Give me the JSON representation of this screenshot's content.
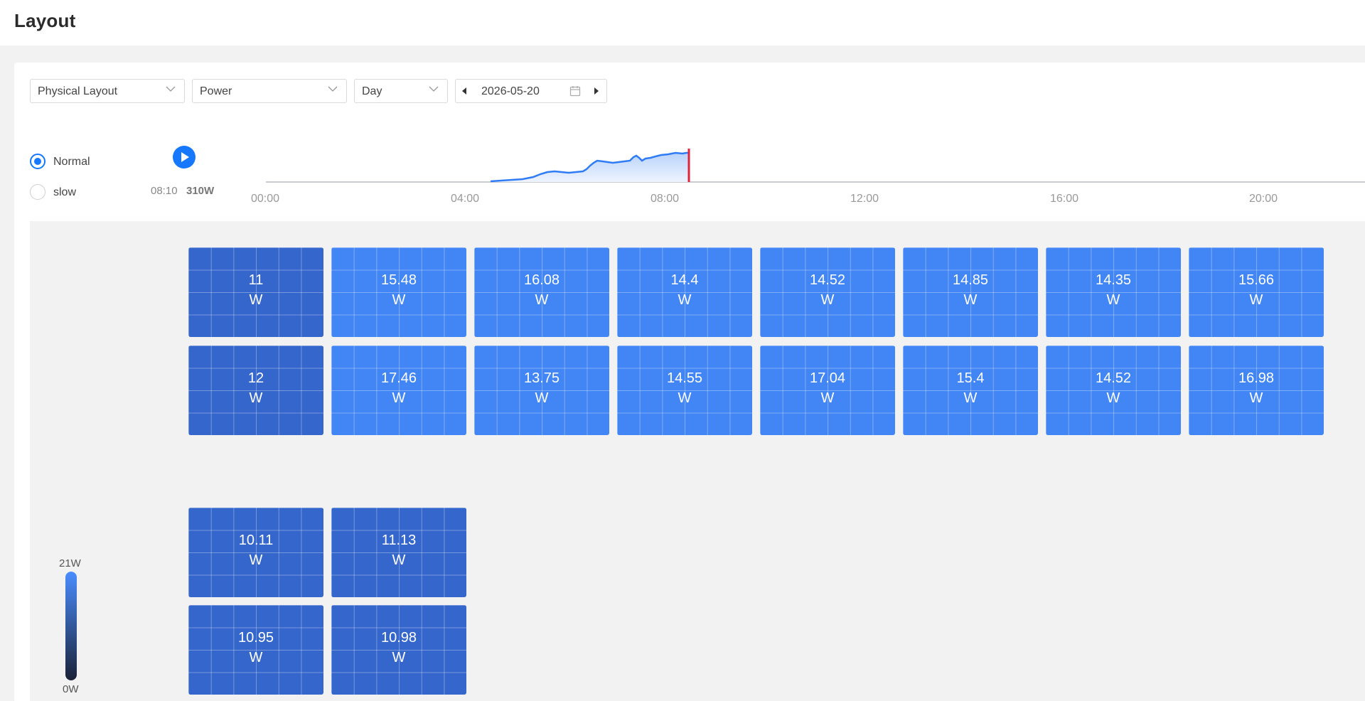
{
  "page": {
    "title": "Layout"
  },
  "filters": {
    "layout_select": "Physical Layout",
    "metric_select": "Power",
    "period_select": "Day",
    "date": "2026-05-20"
  },
  "playback": {
    "speeds": [
      {
        "label": "Normal",
        "selected": true
      },
      {
        "label": "slow",
        "selected": false
      }
    ],
    "current_time": "08:10",
    "current_power": "310W"
  },
  "timeline": {
    "ticks": [
      "00:00",
      "04:00",
      "08:00",
      "12:00",
      "16:00",
      "20:00"
    ],
    "marker_time": "08:10",
    "accent_color": "#1677ff",
    "marker_color": "#e0243b"
  },
  "panels": {
    "row1": [
      {
        "value": "11",
        "unit": "W"
      },
      {
        "value": "15.48",
        "unit": "W"
      },
      {
        "value": "16.08",
        "unit": "W"
      },
      {
        "value": "14.4",
        "unit": "W"
      },
      {
        "value": "14.52",
        "unit": "W"
      },
      {
        "value": "14.85",
        "unit": "W"
      },
      {
        "value": "14.35",
        "unit": "W"
      },
      {
        "value": "15.66",
        "unit": "W"
      }
    ],
    "row2": [
      {
        "value": "12",
        "unit": "W"
      },
      {
        "value": "17.46",
        "unit": "W"
      },
      {
        "value": "13.75",
        "unit": "W"
      },
      {
        "value": "14.55",
        "unit": "W"
      },
      {
        "value": "17.04",
        "unit": "W"
      },
      {
        "value": "15.4",
        "unit": "W"
      },
      {
        "value": "14.52",
        "unit": "W"
      },
      {
        "value": "16.98",
        "unit": "W"
      }
    ],
    "row3": [
      {
        "value": "10.11",
        "unit": "W"
      },
      {
        "value": "11.13",
        "unit": "W"
      }
    ],
    "row4": [
      {
        "value": "10.95",
        "unit": "W"
      },
      {
        "value": "10.98",
        "unit": "W"
      }
    ]
  },
  "legend": {
    "max_label": "21W",
    "min_label": "0W"
  }
}
